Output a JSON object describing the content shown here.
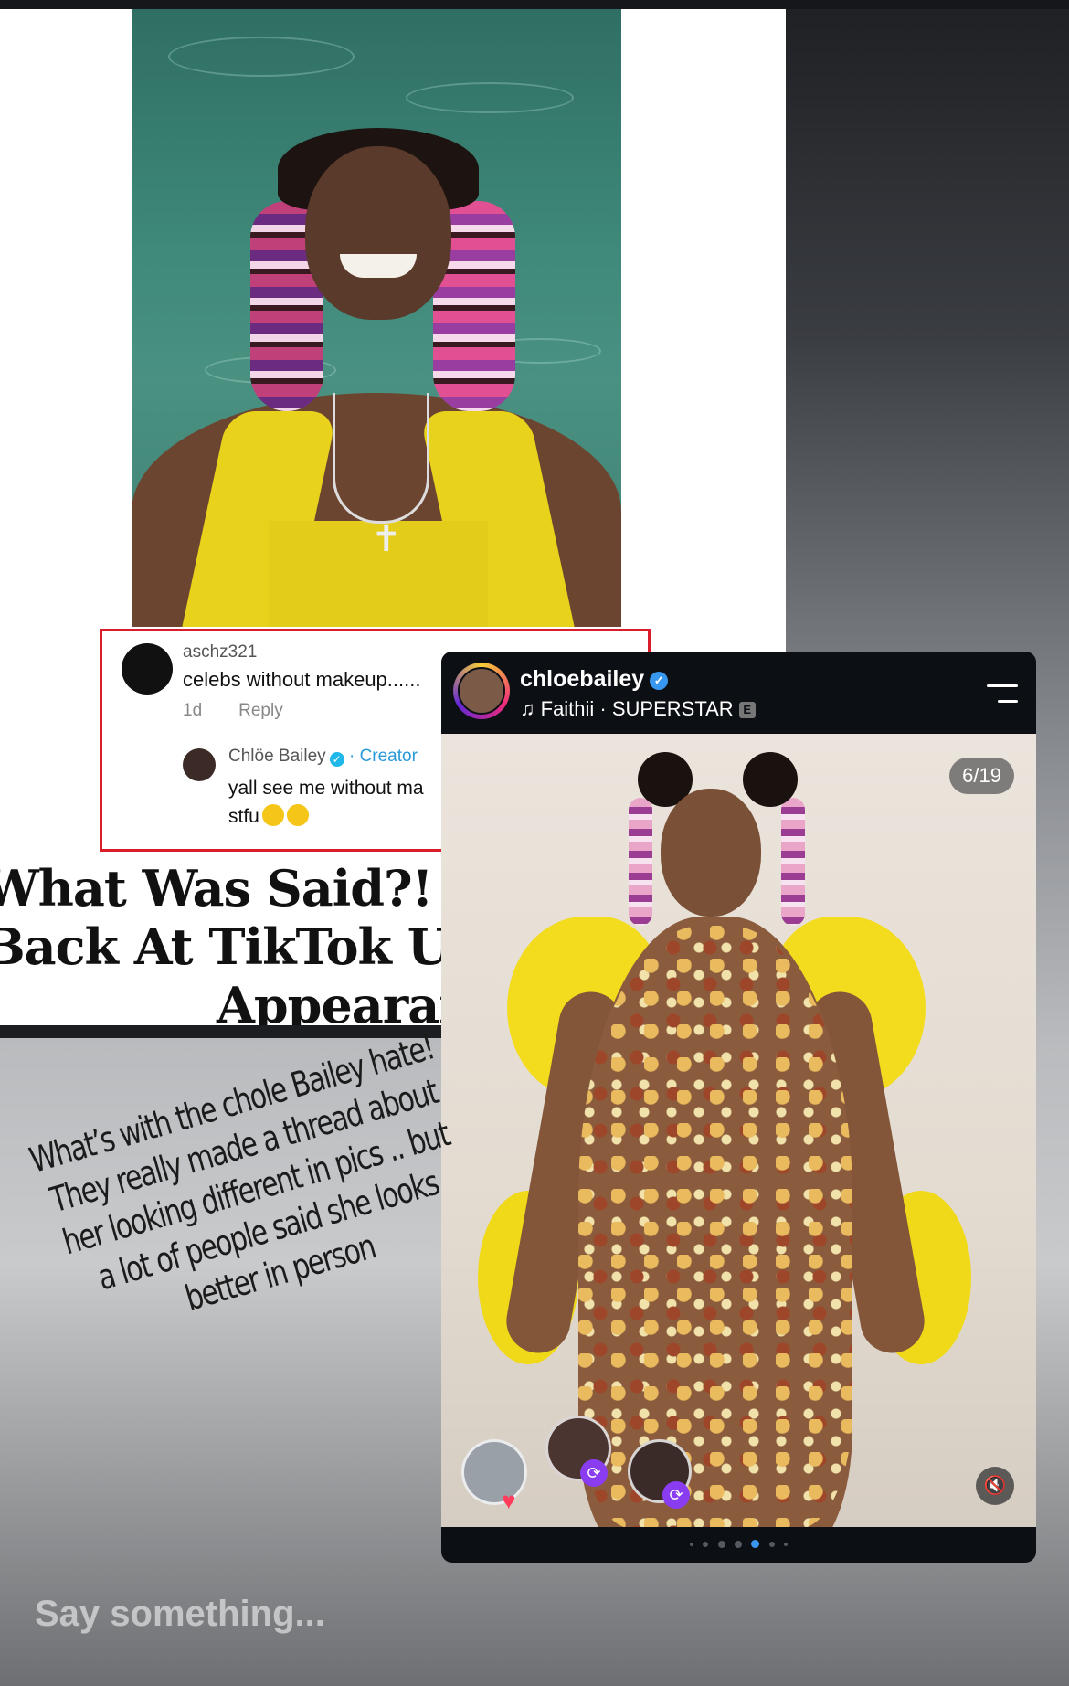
{
  "comment": {
    "username": "aschz321",
    "text": "celebs without makeup......",
    "age": "1d",
    "reply_label": "Reply"
  },
  "reply": {
    "username": "Chlöe Bailey",
    "separator": "·",
    "role": "Creator",
    "text_line1": "yall see me without ma",
    "text_line2": "stfu"
  },
  "headline": {
    "line1": "What Was Said?! Chl",
    "line2": "Back At TikTok Users",
    "line3": "Appearanc"
  },
  "reel": {
    "username": "chloebailey",
    "song": "Faithii · SUPERSTAR",
    "explicit": "E",
    "counter": "6/19"
  },
  "caption": {
    "lines": [
      "What’s with the chole Bailey hate!",
      "They really made a thread about",
      "her looking different in pics .. but",
      "a lot of people said she looks",
      "better in person"
    ]
  },
  "reply_bar": {
    "placeholder": "Say something..."
  },
  "colors": {
    "highlight_border": "#d91d2a",
    "creator_blue": "#2a9ad8",
    "verified_blue": "#3897f0",
    "repost_purple": "#8a3df0"
  },
  "icons": [
    "verified-badge-icon",
    "music-note-icon",
    "menu-icon",
    "mute-icon",
    "repost-icon",
    "heart-icon"
  ]
}
